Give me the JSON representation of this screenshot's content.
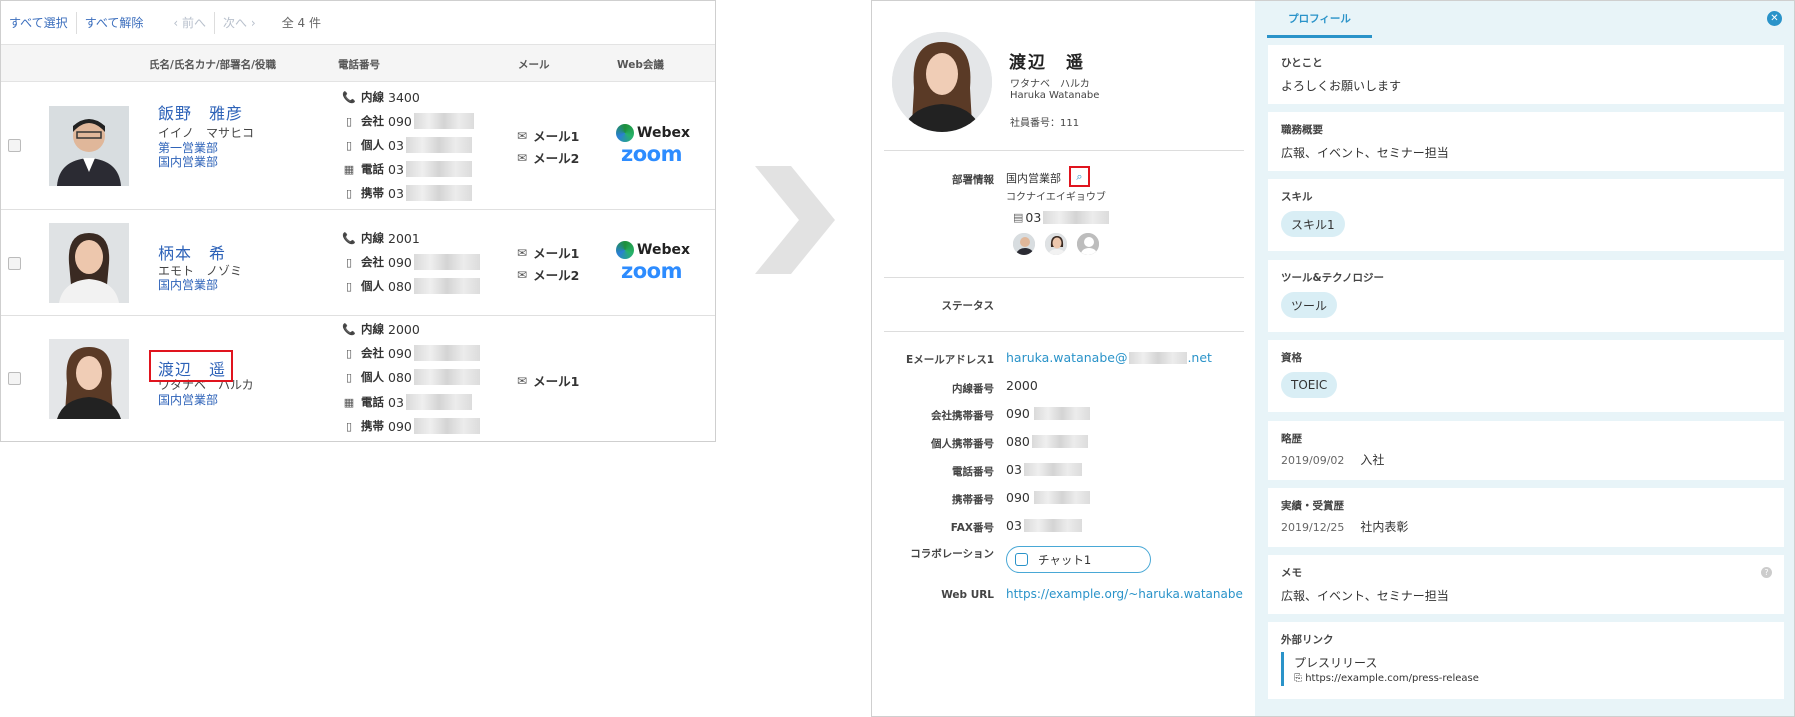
{
  "toolbar": {
    "select_all": "すべて選択",
    "deselect_all": "すべて解除",
    "prev": "前へ",
    "next": "次へ",
    "count": "全 4 件"
  },
  "table_headers": {
    "name": "氏名/氏名カナ/部署名/役職",
    "phone": "電話番号",
    "mail": "メール",
    "web": "Web会議"
  },
  "rows": [
    {
      "name": "飯野　雅彦",
      "kana": "イイノ　マサヒコ",
      "dept1": "第一営業部",
      "dept2": "国内営業部",
      "phones": [
        {
          "label": "内線",
          "value": "3400"
        },
        {
          "label": "会社",
          "value": "090"
        },
        {
          "label": "個人",
          "value": "03"
        },
        {
          "label": "電話",
          "value": "03"
        },
        {
          "label": "携帯",
          "value": "03"
        }
      ],
      "mails": [
        "メール1",
        "メール2"
      ],
      "webex": "Webex",
      "zoom": "zoom"
    },
    {
      "name": "柄本　希",
      "kana": "エモト　ノゾミ",
      "dept1": "国内営業部",
      "phones": [
        {
          "label": "内線",
          "value": "2001"
        },
        {
          "label": "会社",
          "value": "090"
        },
        {
          "label": "個人",
          "value": "080"
        }
      ],
      "mails": [
        "メール1",
        "メール2"
      ],
      "webex": "Webex",
      "zoom": "zoom"
    },
    {
      "name": "渡辺　遥",
      "kana": "ワタナベ　ハルカ",
      "dept1": "国内営業部",
      "phones": [
        {
          "label": "内線",
          "value": "2000"
        },
        {
          "label": "会社",
          "value": "090"
        },
        {
          "label": "個人",
          "value": "080"
        },
        {
          "label": "電話",
          "value": "03"
        },
        {
          "label": "携帯",
          "value": "090"
        }
      ],
      "mails": [
        "メール1"
      ]
    }
  ],
  "detail": {
    "name": "渡辺　遥",
    "kana": "ワタナベ　ハルカ",
    "roman": "Haruka Watanabe",
    "emp_no": "社員番号：111",
    "dept_label": "部署情報",
    "dept_name": "国内営業部",
    "dept_kana": "コクナイエイギョウブ",
    "dept_phone": "03",
    "status_label": "ステータス",
    "fields": [
      {
        "label": "Eメールアドレス1",
        "value": "haruka.watanabe@",
        "suffix": ".net"
      },
      {
        "label": "内線番号",
        "value": "2000"
      },
      {
        "label": "会社携帯番号",
        "value": "090"
      },
      {
        "label": "個人携帯番号",
        "value": "080"
      },
      {
        "label": "電話番号",
        "value": "03"
      },
      {
        "label": "携帯番号",
        "value": "090"
      },
      {
        "label": "FAX番号",
        "value": "03"
      }
    ],
    "collab_label": "コラボレーション",
    "chat": "チャット1",
    "weburl_label": "Web URL",
    "weburl": "https://example.org/~haruka.watanabe"
  },
  "profile": {
    "tab": "プロフィール",
    "hitokoto_title": "ひとこと",
    "hitokoto": "よろしくお願いします",
    "duty_title": "職務概要",
    "duty": "広報、イベント、セミナー担当",
    "skill_title": "スキル",
    "skill": "スキル1",
    "tool_title": "ツール&テクノロジー",
    "tool": "ツール",
    "cert_title": "資格",
    "cert": "TOEIC",
    "history_title": "略歴",
    "history_date": "2019/09/02",
    "history_text": "入社",
    "award_title": "実績・受賞歴",
    "award_date": "2019/12/25",
    "award_text": "社内表彰",
    "memo_title": "メモ",
    "memo": "広報、イベント、セミナー担当",
    "ext_title": "外部リンク",
    "ext_name": "プレスリリース",
    "ext_url": "https://example.com/press-release"
  }
}
